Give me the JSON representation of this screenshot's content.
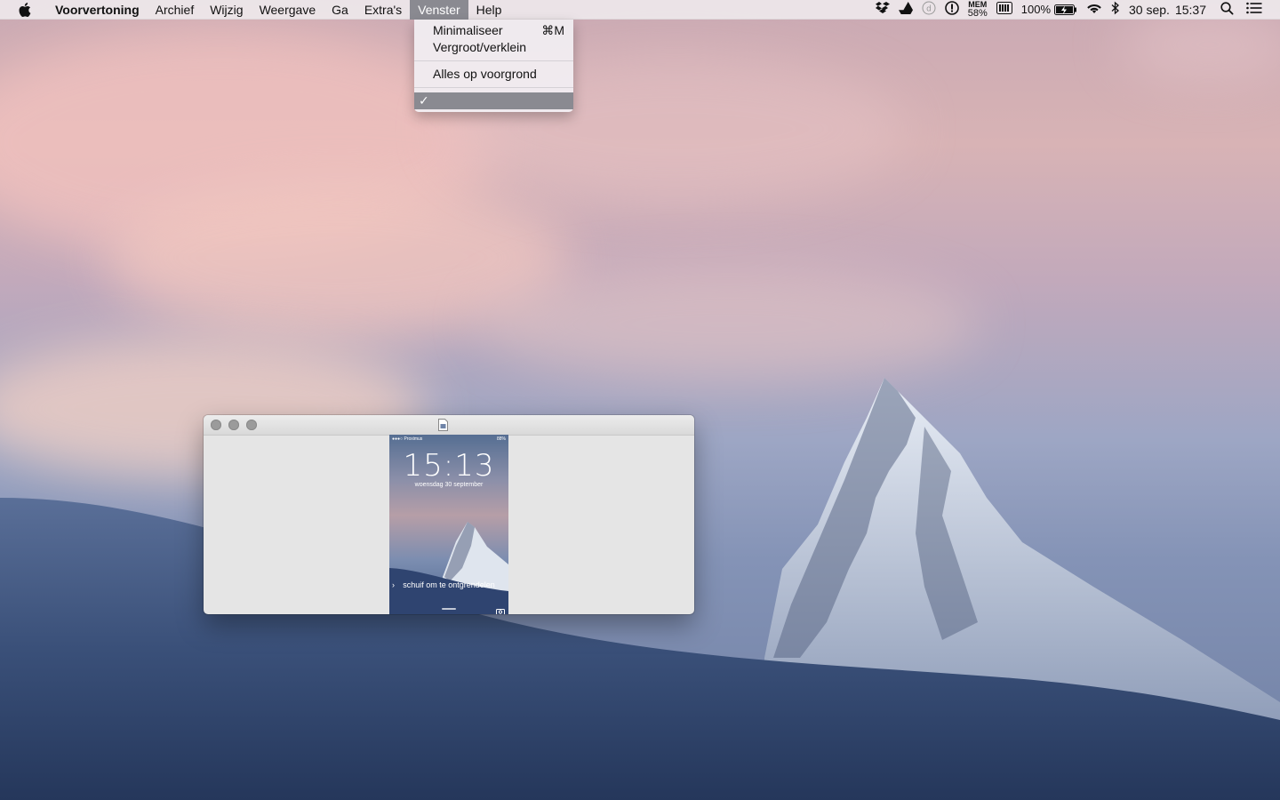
{
  "menubar": {
    "app_name": "Voorvertoning",
    "items": [
      "Archief",
      "Wijzig",
      "Weergave",
      "Ga",
      "Extra's",
      "Venster",
      "Help"
    ],
    "active_item": "Venster",
    "status": {
      "mem_label": "MEM",
      "mem_value": "58%",
      "battery": "100%",
      "date": "30 sep.",
      "time": "15:37"
    }
  },
  "dropdown": {
    "minimize": "Minimaliseer",
    "minimize_shortcut": "⌘M",
    "zoom": "Vergroot/verklein",
    "bring_all": "Alles op voorgrond",
    "checked_mark": "✓"
  },
  "window": {
    "phone": {
      "carrier": "●●●○ Proximus",
      "battery": "88%",
      "time": "15:13",
      "date": "woensdag 30 september",
      "unlock_text": "schuif om te ontgrendelen"
    }
  },
  "colors": {
    "menu_highlight": "#8a8a91",
    "traffic_light": "#9b9b9b"
  }
}
